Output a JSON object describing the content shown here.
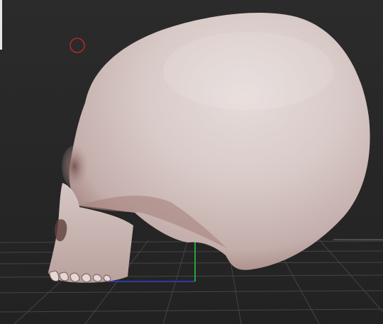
{
  "viewport": {
    "background_color": "#282828",
    "grid_color": "#4a4a4a",
    "brush_cursor_color": "#b02a2a",
    "model_color": "#d9c9c5",
    "model_shadow_color": "#8c6a66",
    "axis_colors": {
      "x": "#2f3aa8",
      "y": "#22a43a"
    },
    "model": "skull-mesh",
    "brush_cursor": "circle-brush-cursor"
  }
}
